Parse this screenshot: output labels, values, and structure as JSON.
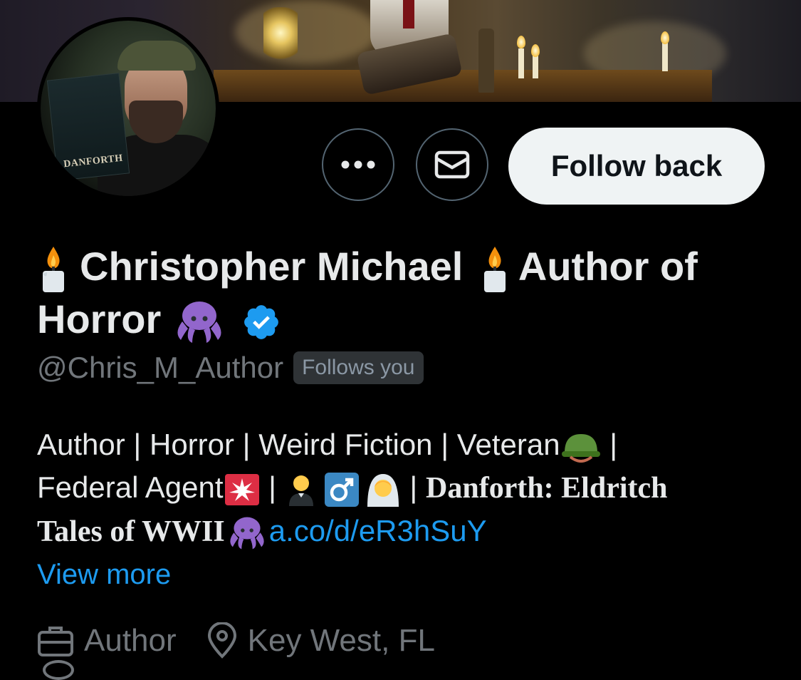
{
  "profile": {
    "display_name_parts": [
      "Christopher Michael",
      "Author of Horror"
    ],
    "handle": "@Chris_M_Author",
    "follows_you_badge": "Follows you",
    "verified": true
  },
  "actions": {
    "follow_back_label": "Follow back",
    "more_icon": "more-horizontal-icon",
    "message_icon": "envelope-icon"
  },
  "bio": {
    "line1": "Author | Horror | Weird Fiction | Veteran",
    "line1_end": " |",
    "line2_start": "Federal Agent",
    "line2_sep1": " | ",
    "line2_sep2": " | ",
    "book_title_a": "Danforth: Eldritch",
    "book_title_b": "Tales of WWII",
    "link": "a.co/d/eR3hSuY",
    "view_more": "View more"
  },
  "meta": {
    "profession": "Author",
    "location": "Key West, FL"
  },
  "avatar_book_text": "DANFORTH",
  "colors": {
    "background": "#000000",
    "text_primary": "#e7e9ea",
    "text_secondary": "#71767b",
    "link": "#1d9bf0",
    "verified": "#1d9bf0",
    "follow_button_bg": "#eff3f4"
  }
}
